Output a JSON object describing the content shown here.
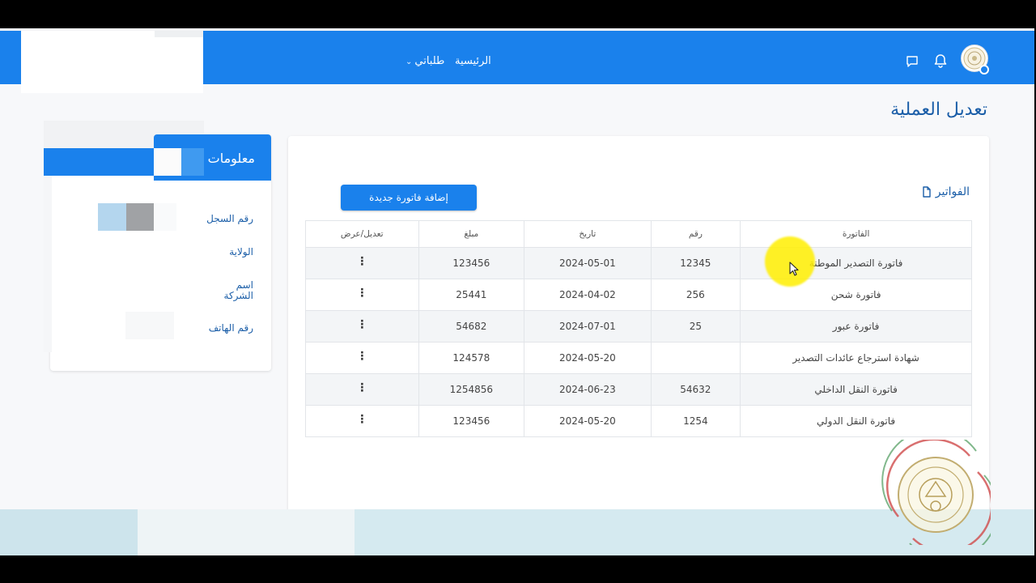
{
  "header": {
    "nav_home": "الرئيسية",
    "nav_orders": "طلباتي",
    "chevron": "⌄",
    "icons": [
      "chat-icon",
      "bell-icon",
      "avatar"
    ]
  },
  "page": {
    "title": "تعديل العملية"
  },
  "info_card": {
    "title": "معلومات ا",
    "labels": [
      "رقم السجل",
      "الولاية",
      "اسم الشركة",
      "رقم الهاتف"
    ]
  },
  "invoices": {
    "section_title": "الفواتير",
    "add_button": "إضافة فاتورة جديدة",
    "columns": [
      "الفاتورة",
      "رقم",
      "تاريخ",
      "مبلغ",
      "تعديل/عرض"
    ],
    "rows": [
      {
        "name": "فاتورة التصدير الموطنة",
        "number": "12345",
        "date": "2024-05-01",
        "amount": "123456"
      },
      {
        "name": "فاتورة شحن",
        "number": "256",
        "date": "2024-04-02",
        "amount": "25441"
      },
      {
        "name": "فاتورة عبور",
        "number": "25",
        "date": "2024-07-01",
        "amount": "54682"
      },
      {
        "name": "شهادة استرجاع عائدات التصدير",
        "number": "",
        "date": "2024-05-20",
        "amount": "124578"
      },
      {
        "name": "فاتورة النقل الداخلي",
        "number": "54632",
        "date": "2024-06-23",
        "amount": "1254856"
      },
      {
        "name": "فاتورة النقل الدولي",
        "number": "1254",
        "date": "2024-05-20",
        "amount": "123456"
      }
    ],
    "row_action_icon": "⋮"
  },
  "colors": {
    "primary": "#1a81ec",
    "title_blue": "#1b5ea8",
    "background": "#f7f8fa"
  }
}
